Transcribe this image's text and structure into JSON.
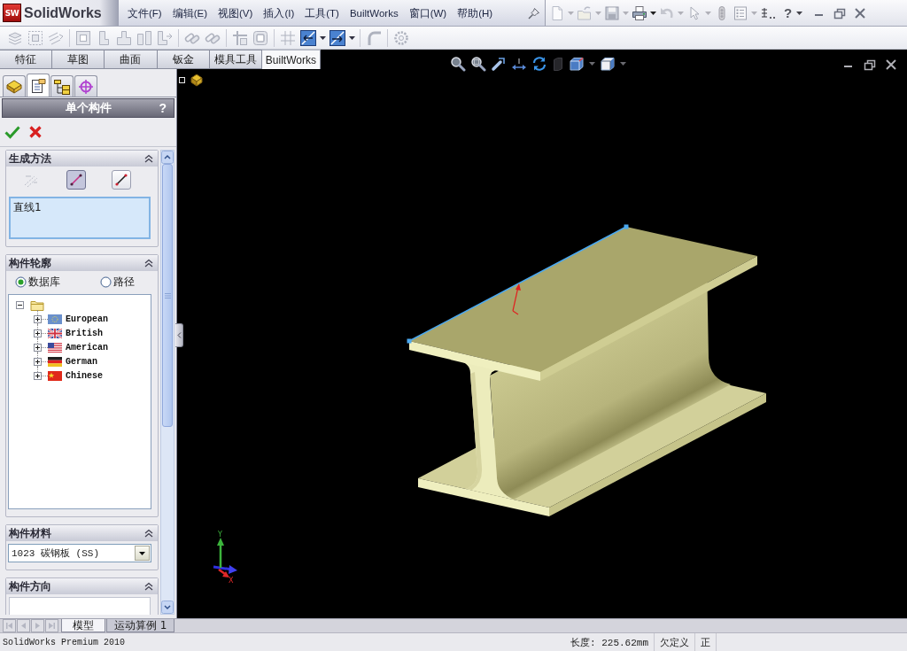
{
  "app": {
    "logo_mark": "SW",
    "name": "SolidWorks",
    "help": "?"
  },
  "menu": [
    "文件(F)",
    "编辑(E)",
    "视图(V)",
    "插入(I)",
    "工具(T)",
    "BuiltWorks",
    "窗口(W)",
    "帮助(H)"
  ],
  "command_toolbar": [
    [
      {
        "kind": "stack",
        "disabled": true
      },
      {
        "kind": "dashed",
        "disabled": true
      },
      {
        "kind": "lines",
        "disabled": true
      }
    ],
    [
      {
        "kind": "panel",
        "disabled": true
      },
      {
        "kind": "bracket",
        "disabled": true
      },
      {
        "kind": "step",
        "disabled": true
      },
      {
        "kind": "columns",
        "disabled": true
      },
      {
        "kind": "profile",
        "disabled": true
      }
    ],
    [
      {
        "kind": "chain",
        "disabled": true
      },
      {
        "kind": "chain",
        "disabled": true
      }
    ],
    [
      {
        "kind": "cross",
        "disabled": true
      },
      {
        "kind": "frame",
        "disabled": true
      }
    ],
    [
      {
        "kind": "grid",
        "disabled": true
      },
      {
        "kind": "trim_start",
        "disabled": false
      },
      {
        "kind": "trim_end",
        "disabled": false
      }
    ],
    [
      {
        "kind": "curve",
        "disabled": true
      }
    ],
    [
      {
        "kind": "gear",
        "disabled": true
      }
    ]
  ],
  "command_tabs": [
    {
      "label": "特征",
      "selected": false
    },
    {
      "label": "草图",
      "selected": false
    },
    {
      "label": "曲面",
      "selected": false
    },
    {
      "label": "钣金",
      "selected": false
    },
    {
      "label": "模具工具",
      "selected": false
    },
    {
      "label": "BuiltWorks",
      "selected": true
    }
  ],
  "panel_tabs": [
    {
      "kind": "feature",
      "selected": false
    },
    {
      "kind": "property",
      "selected": true
    },
    {
      "kind": "configuration",
      "selected": false
    },
    {
      "kind": "dimxpert",
      "selected": false
    }
  ],
  "property_manager": {
    "title": "单个构件",
    "help": "?",
    "groups": [
      {
        "kind": "method",
        "title": "生成方法",
        "expanded": true,
        "methods": [
          {
            "kind": "sketch3d",
            "selected": false,
            "disabled": true
          },
          {
            "kind": "line",
            "selected": true,
            "disabled": false
          },
          {
            "kind": "edge",
            "selected": false,
            "disabled": false
          }
        ],
        "selections": [
          "直线1"
        ]
      },
      {
        "kind": "profile",
        "title": "构件轮廓",
        "expanded": true,
        "options": [
          {
            "label": "数据库",
            "selected": true
          },
          {
            "label": "路径",
            "selected": false
          }
        ],
        "tree": {
          "expanded": true,
          "children": [
            {
              "label": "European",
              "kind": "eu",
              "expanded": false
            },
            {
              "label": "British",
              "kind": "gb",
              "expanded": false
            },
            {
              "label": "American",
              "kind": "us",
              "expanded": false
            },
            {
              "label": "German",
              "kind": "de",
              "expanded": false
            },
            {
              "label": "Chinese",
              "kind": "cn",
              "expanded": false
            }
          ]
        }
      },
      {
        "kind": "material",
        "title": "构件材料",
        "expanded": true,
        "value": "1023 碳钢板 (SS)"
      },
      {
        "kind": "orientation",
        "title": "构件方向",
        "expanded": true
      }
    ]
  },
  "viewport": {
    "axes": [
      {
        "label": "Y",
        "color": "#3cb43c"
      },
      {
        "label": "X",
        "color": "#e02828"
      }
    ]
  },
  "bottom_tabs": [
    {
      "label": "模型",
      "selected": true
    },
    {
      "label": "运动算例 1",
      "selected": false
    }
  ],
  "status_bar": {
    "product": "SolidWorks Premium 2010",
    "fields": [
      "长度: 225.62mm",
      "欠定义",
      "正"
    ]
  }
}
